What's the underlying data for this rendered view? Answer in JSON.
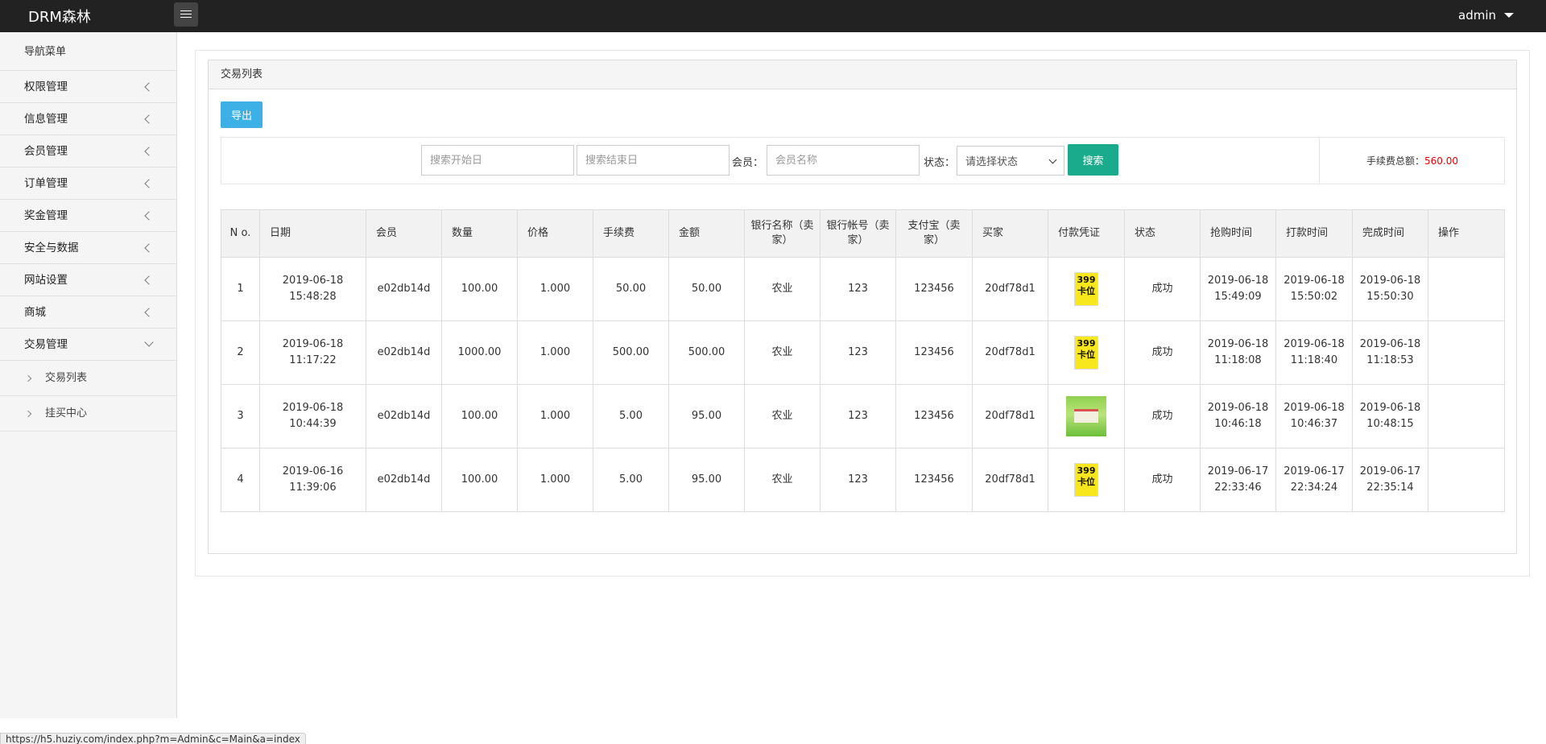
{
  "topbar": {
    "brand": "DRM森林",
    "user": "admin"
  },
  "sidebar": {
    "header": "导航菜单",
    "items": [
      {
        "label": "权限管理"
      },
      {
        "label": "信息管理"
      },
      {
        "label": "会员管理"
      },
      {
        "label": "订单管理"
      },
      {
        "label": "奖金管理"
      },
      {
        "label": "安全与数据"
      },
      {
        "label": "网站设置"
      },
      {
        "label": "商城"
      },
      {
        "label": "交易管理"
      }
    ],
    "subitems": [
      {
        "label": "交易列表"
      },
      {
        "label": "挂买中心"
      }
    ]
  },
  "panel": {
    "title": "交易列表",
    "export_label": "导出"
  },
  "search": {
    "start_placeholder": "搜索开始日",
    "end_placeholder": "搜索结束日",
    "member_label": "会员：",
    "member_placeholder": "会员名称",
    "status_label": "状态：",
    "status_selected": "请选择状态",
    "search_label": "搜索",
    "fee_label": "手续费总额：",
    "fee_value": "560.00"
  },
  "table": {
    "headers": [
      "N o.",
      "日期",
      "会员",
      "数量",
      "价格",
      "手续费",
      "金额",
      "银行名称（卖家）",
      "银行帐号（卖家）",
      "支付宝（卖家）",
      "买家",
      "付款凭证",
      "状态",
      "抢购时间",
      "打款时间",
      "完成时间",
      "操作"
    ],
    "voucher_text": [
      "399",
      "卡位"
    ],
    "rows": [
      {
        "no": "1",
        "date": "2019-06-18 15:48:28",
        "member": "e02db14d",
        "qty": "100.00",
        "price": "1.000",
        "fee": "50.00",
        "amount": "50.00",
        "bank": "农业",
        "account": "123",
        "alipay": "123456",
        "buyer": "20df78d1",
        "voucher": "card",
        "status": "成功",
        "grab": "2019-06-18 15:49:09",
        "pay": "2019-06-18 15:50:02",
        "done": "2019-06-18 15:50:30",
        "op": ""
      },
      {
        "no": "2",
        "date": "2019-06-18 11:17:22",
        "member": "e02db14d",
        "qty": "1000.00",
        "price": "1.000",
        "fee": "500.00",
        "amount": "500.00",
        "bank": "农业",
        "account": "123",
        "alipay": "123456",
        "buyer": "20df78d1",
        "voucher": "card",
        "status": "成功",
        "grab": "2019-06-18 11:18:08",
        "pay": "2019-06-18 11:18:40",
        "done": "2019-06-18 11:18:53",
        "op": ""
      },
      {
        "no": "3",
        "date": "2019-06-18 10:44:39",
        "member": "e02db14d",
        "qty": "100.00",
        "price": "1.000",
        "fee": "5.00",
        "amount": "95.00",
        "bank": "农业",
        "account": "123",
        "alipay": "123456",
        "buyer": "20df78d1",
        "voucher": "photo",
        "status": "成功",
        "grab": "2019-06-18 10:46:18",
        "pay": "2019-06-18 10:46:37",
        "done": "2019-06-18 10:48:15",
        "op": ""
      },
      {
        "no": "4",
        "date": "2019-06-16 11:39:06",
        "member": "e02db14d",
        "qty": "100.00",
        "price": "1.000",
        "fee": "5.00",
        "amount": "95.00",
        "bank": "农业",
        "account": "123",
        "alipay": "123456",
        "buyer": "20df78d1",
        "voucher": "card",
        "status": "成功",
        "grab": "2019-06-17 22:33:46",
        "pay": "2019-06-17 22:34:24",
        "done": "2019-06-17 22:35:14",
        "op": ""
      }
    ]
  },
  "statusbar": {
    "url": "https://h5.huziy.com/index.php?m=Admin&c=Main&a=index"
  }
}
